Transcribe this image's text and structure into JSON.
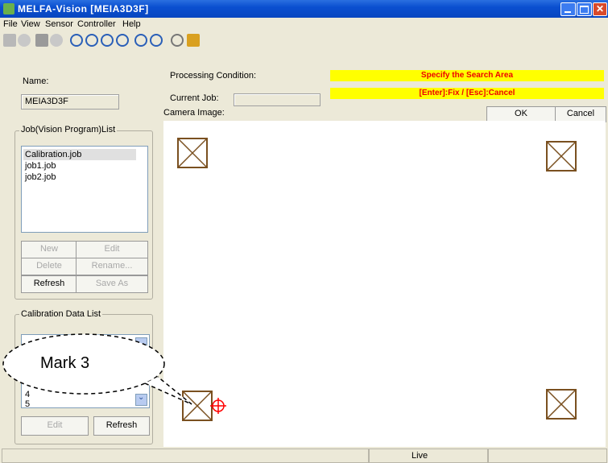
{
  "window": {
    "title": "MELFA-Vision [MEIA3D3F]"
  },
  "menu": [
    "File",
    "View",
    "Sensor",
    "Controller",
    "Help"
  ],
  "name_label": "Name:",
  "name_value": "MEIA3D3F",
  "processing_label": "Processing Condition:",
  "current_job_label": "Current Job:",
  "camera_image_label": "Camera Image:",
  "messages": {
    "line1": "Specify the Search Area",
    "line2": "[Enter]:Fix / [Esc]:Cancel"
  },
  "ok_label": "OK",
  "cancel_label": "Cancel",
  "job_group": {
    "title": "Job(Vision Program)List",
    "items": [
      "Calibration.job",
      "job1.job",
      "job2.job"
    ],
    "buttons": {
      "new": "New",
      "edit": "Edit",
      "delete": "Delete",
      "rename": "Rename...",
      "refresh": "Refresh",
      "save_as": "Save As"
    }
  },
  "calib_group": {
    "title": "Calibration Data List",
    "items": [
      "4",
      "5"
    ],
    "buttons": {
      "edit": "Edit",
      "refresh": "Refresh"
    }
  },
  "callout": "Mark 3",
  "status": {
    "live": "Live"
  },
  "colors": {
    "highlight": "#ffff00",
    "highlight_text": "#e00000",
    "marker": "#7a5020",
    "crosshair": "#ff0000"
  }
}
